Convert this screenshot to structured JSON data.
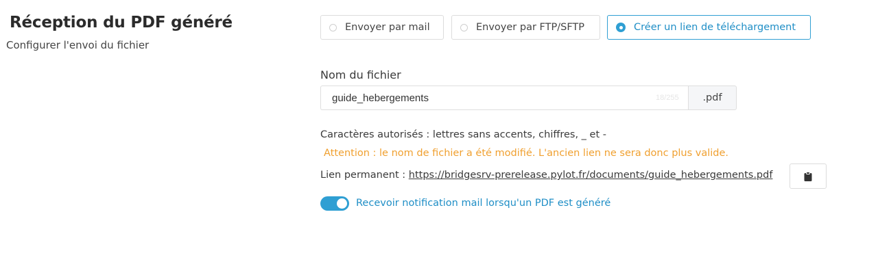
{
  "section": {
    "title": "Réception du PDF généré",
    "subtitle": "Configurer l'envoi du fichier"
  },
  "delivery_options": [
    {
      "label": "Envoyer par mail",
      "selected": false
    },
    {
      "label": "Envoyer par FTP/SFTP",
      "selected": false
    },
    {
      "label": "Créer un lien de téléchargement",
      "selected": true
    }
  ],
  "filename": {
    "label": "Nom du fichier",
    "value": "guide_hebergements",
    "counter": "18/255",
    "extension": ".pdf"
  },
  "help_text": "Caractères autorisés : lettres sans accents, chiffres, _ et -",
  "warning_text": "Attention : le nom de fichier a été modifié. L'ancien lien ne sera donc plus valide.",
  "permalink": {
    "label": "Lien permanent : ",
    "url": "https://bridgesrv-prerelease.pylot.fr/documents/guide_hebergements.pdf",
    "copy_icon": "clipboard-icon"
  },
  "notification": {
    "label": "Recevoir notification mail lorsqu'un PDF est généré",
    "enabled": true
  },
  "colors": {
    "accent": "#2f9fd3",
    "warning": "#f0a030"
  }
}
